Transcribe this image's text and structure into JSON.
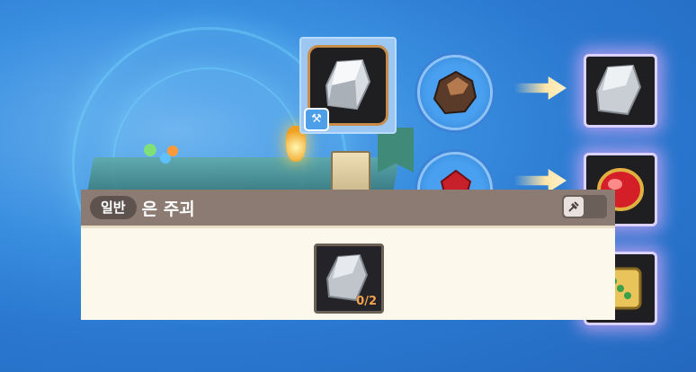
{
  "item": {
    "rarity_badge": "일반",
    "name": "은 주괴",
    "pin_icon": "pin-icon"
  },
  "material": {
    "count": "0/2"
  },
  "colors": {
    "background": "#2a78d0",
    "header": "#8b7b72",
    "panel": "#fdf8ec",
    "badge": "#5d524e",
    "count": "#f2a14e",
    "slot_border": "#c98d4a"
  },
  "icons": {
    "selected_tag": "workbench-icon",
    "arrows": "arrow-right-icon"
  }
}
